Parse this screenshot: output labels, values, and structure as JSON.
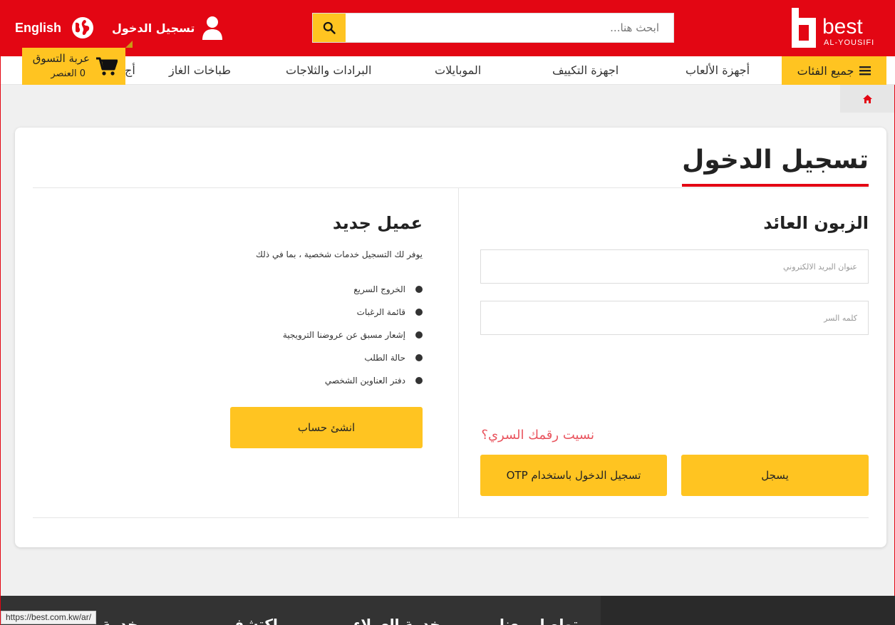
{
  "header": {
    "logo_word": "best",
    "logo_sub": "AL-YOUSIFI",
    "search_placeholder": "ابحث هنا...",
    "login_label": "تسجيل الدخول",
    "language_label": "English",
    "brand_color": "#e30613",
    "accent_color": "#ffc421"
  },
  "nav": {
    "all_categories": "جميع الفئات",
    "items": [
      "أجهزة الألعاب",
      "اجهزة التكييف",
      "الموبايلات",
      "البرادات والثلاجات",
      "طباخات الغاز",
      "أج"
    ]
  },
  "cart": {
    "title": "عربة التسوق",
    "count": "0 العنصر"
  },
  "page": {
    "title": "تسجيل الدخول"
  },
  "returning": {
    "title": "الزبون العائد",
    "email_placeholder": "عنوان البريد الالكتروني",
    "password_placeholder": "كلمه السر",
    "forgot": "نسيت رقمك السري؟",
    "login_button": "يسجل",
    "otp_button": "تسجيل الدخول باستخدام OTP"
  },
  "new_customer": {
    "title": "عميل جديد",
    "description": "يوفر لك التسجيل خدمات شخصية ، بما في ذلك",
    "benefits": [
      "الخروج السريع",
      "قائمة الرغبات",
      "إشعار مسبق عن عروضنا الترويجية",
      "حالة الطلب",
      "دفتر العناوين الشخصي"
    ],
    "create_button": "انشئ حساب"
  },
  "footer": {
    "items": [
      "تواصل معنا",
      "خدمة العملاء",
      "اكتشف",
      "خدمة"
    ]
  },
  "status_bar": {
    "url": "https://best.com.kw/ar/"
  }
}
